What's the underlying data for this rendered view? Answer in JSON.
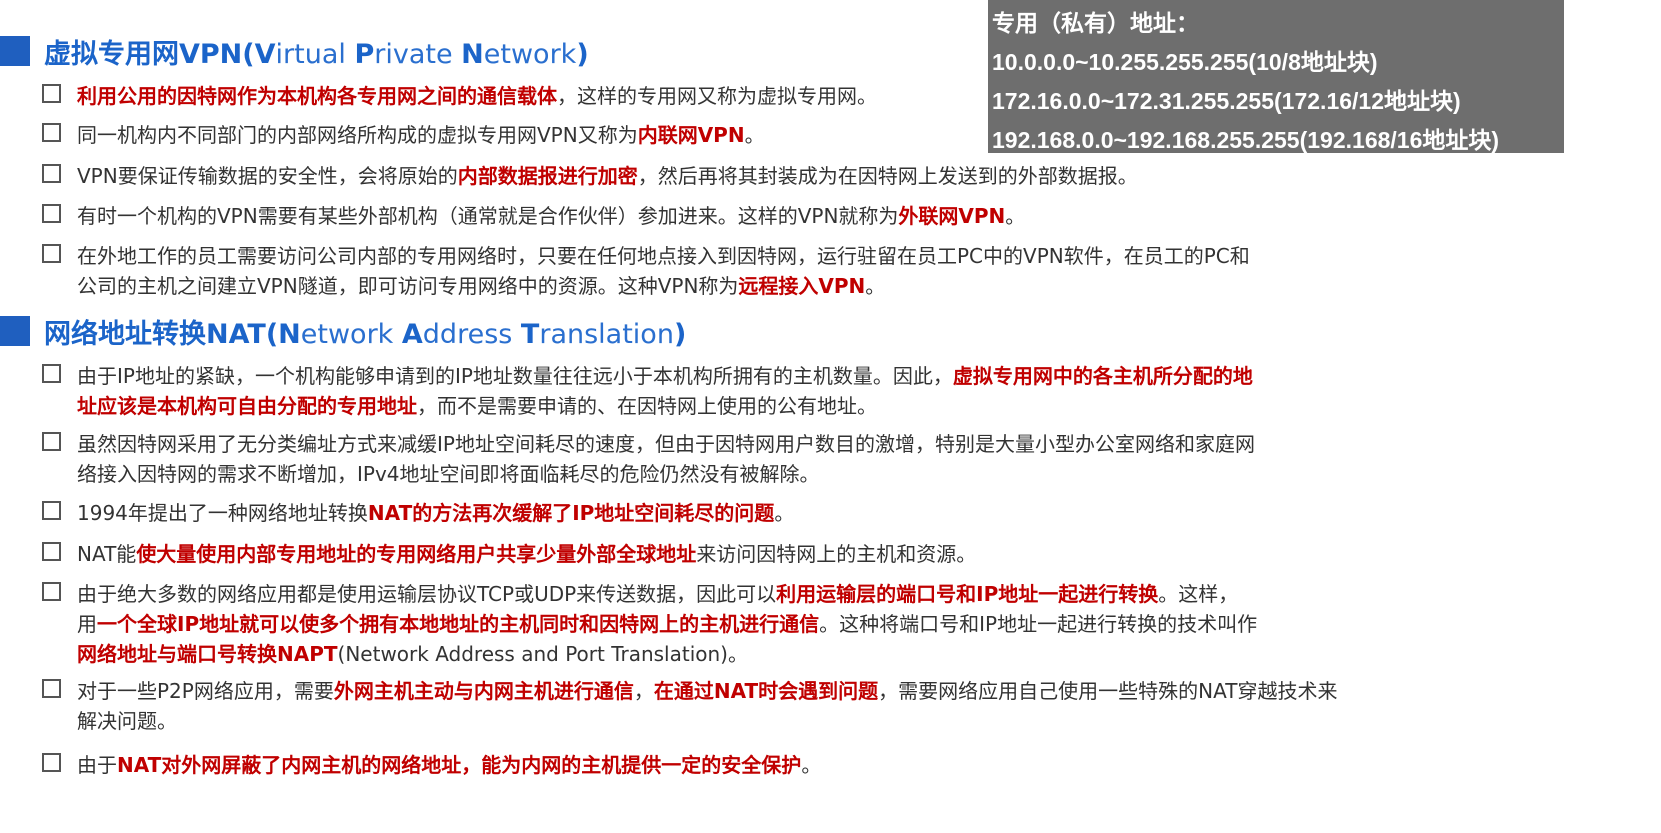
{
  "info_box": {
    "title": "专用（私有）地址：",
    "lines": [
      "10.0.0.0~10.255.255.255(10/8地址块)",
      "172.16.0.0~172.31.255.255(172.16/12地址块)",
      "192.168.0.0~192.168.255.255(192.168/16地址块)"
    ]
  },
  "vpn": {
    "title_prefix": "虚拟专用网VPN(",
    "title_v": "V",
    "title_irtual": "irtual ",
    "title_p": "P",
    "title_rivate": "rivate ",
    "title_n": "N",
    "title_etwork": "etwork",
    "title_suffix": ")",
    "items": [
      {
        "red1": "利用公用的因特网作为本机构各专用网之间的通信载体",
        "t1": "，这样的专用网又称为虚拟专用网。"
      },
      {
        "t1": "同一机构内不同部门的内部网络所构成的虚拟专用网VPN又称为",
        "red1": "内联网VPN",
        "t2": "。"
      },
      {
        "t1": "VPN要保证传输数据的安全性，会将原始的",
        "red1": "内部数据报进行加密",
        "t2": "，然后再将其封装成为在因特网上发送到的外部数据报。"
      },
      {
        "t1": "有时一个机构的VPN需要有某些外部机构（通常就是合作伙伴）参加进来。这样的VPN就称为",
        "red1": "外联网VPN",
        "t2": "。"
      },
      {
        "line1": "在外地工作的员工需要访问公司内部的专用网络时，只要在任何地点接入到因特网，运行驻留在员工PC中的VPN软件，在员工的PC和",
        "t1": "公司的主机之间建立VPN隧道，即可访问专用网络中的资源。这种VPN称为",
        "red1": "远程接入VPN",
        "t2": "。"
      }
    ]
  },
  "nat": {
    "title_prefix": "网络地址转换NAT(",
    "title_n": "N",
    "title_etwork": "etwork ",
    "title_a": "A",
    "title_ddress": "ddress ",
    "title_t": "T",
    "title_ranslation": "ranslation",
    "title_suffix": ")",
    "items": [
      {
        "t1": "由于IP地址的紧缺，一个机构能够申请到的IP地址数量往往远小于本机构所拥有的主机数量。因此，",
        "red1": "虚拟专用网中的各主机所分配的地",
        "red2": "址应该是本机构可自由分配的专用地址",
        "t2": "，而不是需要申请的、在因特网上使用的公有地址。"
      },
      {
        "line1": "虽然因特网采用了无分类编址方式来减缓IP地址空间耗尽的速度，但由于因特网用户数目的激增，特别是大量小型办公室网络和家庭网",
        "line2": "络接入因特网的需求不断增加，IPv4地址空间即将面临耗尽的危险仍然没有被解除。"
      },
      {
        "t1": "1994年提出了一种网络地址转换",
        "red1": "NAT的方法再次缓解了IP地址空间耗尽的问题",
        "t2": "。"
      },
      {
        "t1": "NAT能",
        "red1": "使大量使用内部专用地址的专用网络用户共享少量外部全球地址",
        "t2": "来访问因特网上的主机和资源。"
      },
      {
        "t1": "由于绝大多数的网络应用都是使用运输层协议TCP或UDP来传送数据，因此可以",
        "red1": "利用运输层的端口号和IP地址一起进行转换",
        "t2": "。这样，",
        "t3": "用",
        "red2": "一个全球IP地址就可以使多个拥有本地地址的主机同时和因特网上的主机进行通信",
        "t4": "。这种将端口号和IP地址一起进行转换的技术叫作",
        "red3": "网络地址与端口号转换NAPT",
        "t5": "(Network Address and Port Translation)。"
      },
      {
        "t1": "对于一些P2P网络应用，需要",
        "red1": "外网主机主动与内网主机进行通信",
        "t2": "，",
        "red2": "在通过NAT时会遇到问题",
        "t3": "，需要网络应用自己使用一些特殊的NAT穿越技术来",
        "line2": "解决问题。"
      },
      {
        "t1": "由于",
        "red1": "NAT对外网屏蔽了内网主机的网络地址，能为内网的主机提供一定的安全保护",
        "t2": "。"
      }
    ]
  }
}
